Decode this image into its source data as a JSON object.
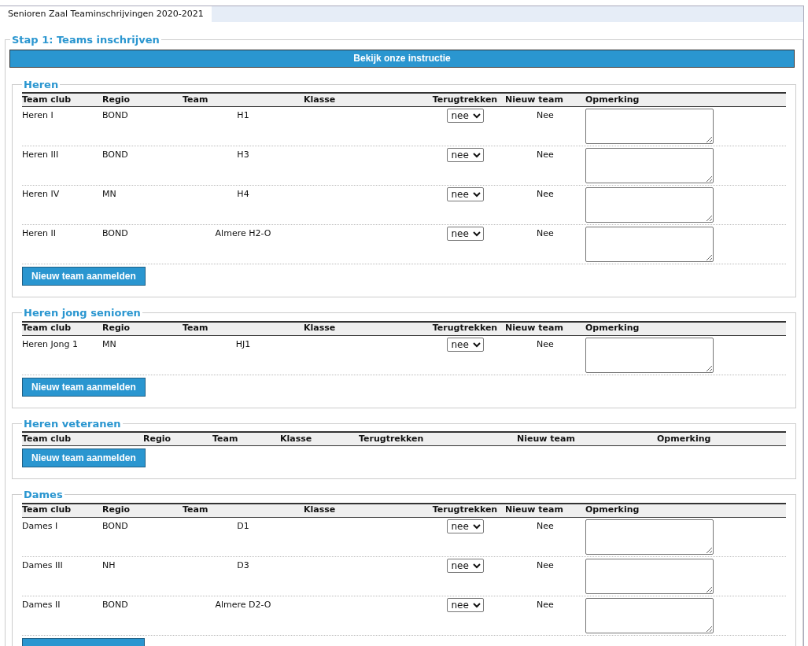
{
  "tab": {
    "label": "Senioren Zaal Teaminschrijvingen 2020-2021",
    "selected": true
  },
  "step": {
    "title": "Stap 1: Teams inschrijven",
    "instruction_button": "Bekijk onze instructie"
  },
  "sections": [
    {
      "title": "Heren",
      "columns": [
        "Team club",
        "Regio",
        "Team",
        "Klasse",
        "Terugtrekken",
        "Nieuw team",
        "Opmerking"
      ],
      "rows": [
        {
          "team_club": "Heren I",
          "regio": "BOND",
          "team": "H1",
          "withdraw": "nee",
          "new_team": "Nee"
        },
        {
          "team_club": "Heren III",
          "regio": "BOND",
          "team": "H3",
          "withdraw": "nee",
          "new_team": "Nee"
        },
        {
          "team_club": "Heren IV",
          "regio": "MN",
          "team": "H4",
          "withdraw": "nee",
          "new_team": "Nee"
        },
        {
          "team_club": "Heren II",
          "regio": "BOND",
          "team": "Almere H2-O",
          "withdraw": "nee",
          "new_team": "Nee"
        }
      ],
      "add_button": "Nieuw team aanmelden"
    },
    {
      "title": "Heren jong senioren",
      "columns": [
        "Team club",
        "Regio",
        "Team",
        "Klasse",
        "Terugtrekken",
        "Nieuw team",
        "Opmerking"
      ],
      "rows": [
        {
          "team_club": "Heren Jong 1",
          "regio": "MN",
          "team": "HJ1",
          "withdraw": "nee",
          "new_team": "Nee"
        }
      ],
      "add_button": "Nieuw team aanmelden"
    },
    {
      "title": "Heren veteranen",
      "columns": [
        "Team club",
        "Regio",
        "Team",
        "Klasse",
        "Terugtrekken",
        "Nieuw team",
        "Opmerking"
      ],
      "add_button": "Nieuw team aanmelden"
    },
    {
      "title": "Dames",
      "columns": [
        "Team club",
        "Regio",
        "Team",
        "Klasse",
        "Terugtrekken",
        "Nieuw team",
        "Opmerking"
      ],
      "rows": [
        {
          "team_club": "Dames I",
          "regio": "BOND",
          "team": "D1",
          "withdraw": "nee",
          "new_team": "Nee"
        },
        {
          "team_club": "Dames III",
          "regio": "NH",
          "team": "D3",
          "withdraw": "nee",
          "new_team": "Nee"
        },
        {
          "team_club": "Dames II",
          "regio": "BOND",
          "team": "Almere D2-O",
          "withdraw": "nee",
          "new_team": "Nee"
        }
      ],
      "add_button_cut": true
    }
  ]
}
